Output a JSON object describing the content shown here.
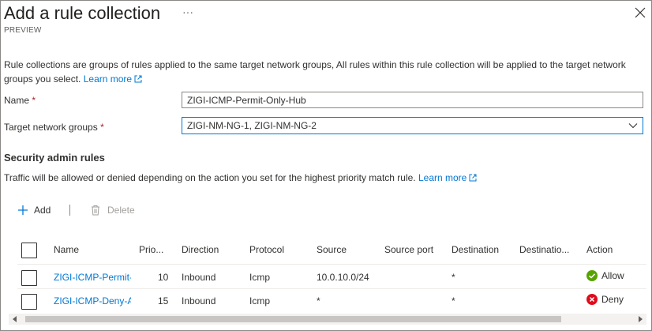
{
  "panel": {
    "title": "Add a rule collection",
    "more_label": "···",
    "subtitle": "PREVIEW"
  },
  "description": {
    "text": "Rule collections are groups of rules applied to the same target network groups, All rules within this rule collection will be applied to the target network groups you select.",
    "learn_more": "Learn more"
  },
  "form": {
    "name_label": "Name",
    "name_value": "ZIGI-ICMP-Permit-Only-Hub",
    "target_label": "Target network groups",
    "target_value": "ZIGI-NM-NG-1, ZIGI-NM-NG-2",
    "required_mark": "*"
  },
  "rules_section": {
    "title": "Security admin rules",
    "description": "Traffic will be allowed or denied depending on the action you set for the highest priority match rule.",
    "learn_more": "Learn more"
  },
  "toolbar": {
    "add_label": "Add",
    "delete_label": "Delete"
  },
  "table": {
    "columns": [
      "Name",
      "Prio...",
      "Direction",
      "Protocol",
      "Source",
      "Source port",
      "Destination",
      "Destinatio...",
      "Action"
    ],
    "rows": [
      {
        "name": "ZIGI-ICMP-Permit-I",
        "priority": "10",
        "direction": "Inbound",
        "protocol": "Icmp",
        "source": "10.0.10.0/24",
        "source_port": "",
        "destination": "*",
        "destination_port": "",
        "action": "Allow",
        "action_status": "allow"
      },
      {
        "name": "ZIGI-ICMP-Deny-A",
        "priority": "15",
        "direction": "Inbound",
        "protocol": "Icmp",
        "source": "*",
        "source_port": "",
        "destination": "*",
        "destination_port": "",
        "action": "Deny",
        "action_status": "deny"
      }
    ]
  },
  "colors": {
    "link": "#0078d4",
    "allow": "#57a300",
    "deny": "#e00b1c",
    "required": "#a4262c"
  }
}
